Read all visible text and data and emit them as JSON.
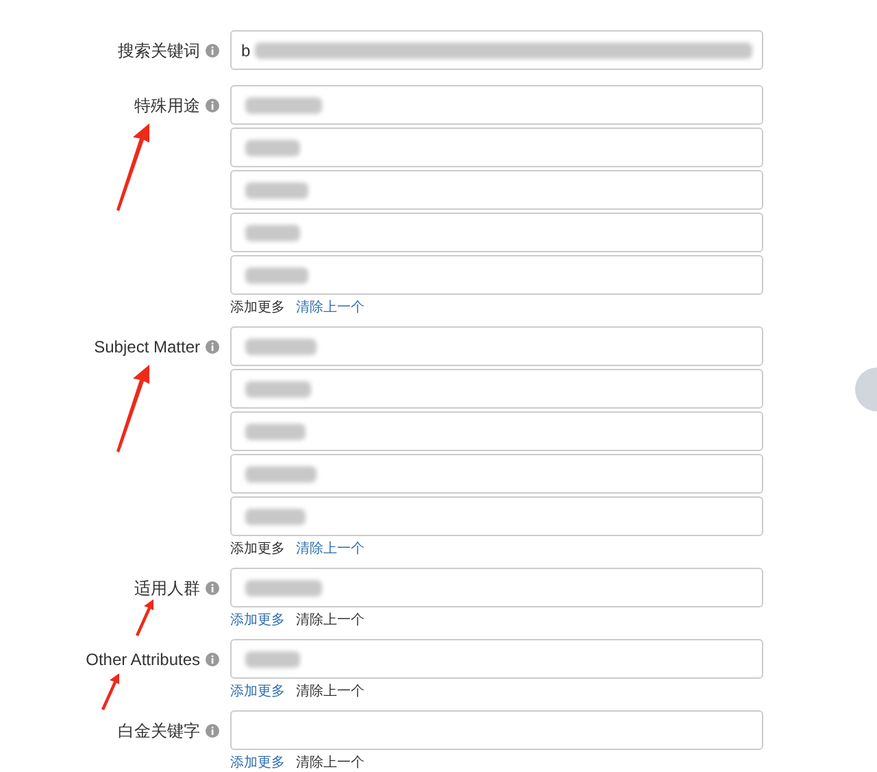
{
  "rows": [
    {
      "label": "搜索关键词",
      "arrow": false,
      "fields": [
        {
          "value": "b",
          "blurred": true,
          "wide": true
        }
      ]
    },
    {
      "label": "特殊用途",
      "arrow": true,
      "fields": [
        {
          "blurred": true
        },
        {
          "blurred": true
        },
        {
          "blurred": true
        },
        {
          "blurred": true
        },
        {
          "blurred": true
        }
      ],
      "links": [
        {
          "label": "添加更多",
          "disabled": true
        },
        {
          "label": "清除上一个",
          "disabled": false
        }
      ]
    },
    {
      "label": "Subject Matter",
      "arrow": true,
      "fields": [
        {
          "blurred": true
        },
        {
          "blurred": true
        },
        {
          "blurred": true
        },
        {
          "blurred": true
        },
        {
          "blurred": true
        }
      ],
      "links": [
        {
          "label": "添加更多",
          "disabled": true
        },
        {
          "label": "清除上一个",
          "disabled": false
        }
      ]
    },
    {
      "label": "适用人群",
      "arrow": true,
      "fields": [
        {
          "blurred": true
        }
      ],
      "links": [
        {
          "label": "添加更多",
          "disabled": false
        },
        {
          "label": "清除上一个",
          "disabled": true
        }
      ]
    },
    {
      "label": "Other Attributes",
      "arrow": true,
      "fields": [
        {
          "blurred": true
        }
      ],
      "links": [
        {
          "label": "添加更多",
          "disabled": false
        },
        {
          "label": "清除上一个",
          "disabled": true
        }
      ]
    },
    {
      "label": "白金关键字",
      "arrow": false,
      "fields": [
        {
          "blurred": false
        }
      ],
      "links": [
        {
          "label": "添加更多",
          "disabled": false
        },
        {
          "label": "清除上一个",
          "disabled": true
        }
      ]
    }
  ]
}
